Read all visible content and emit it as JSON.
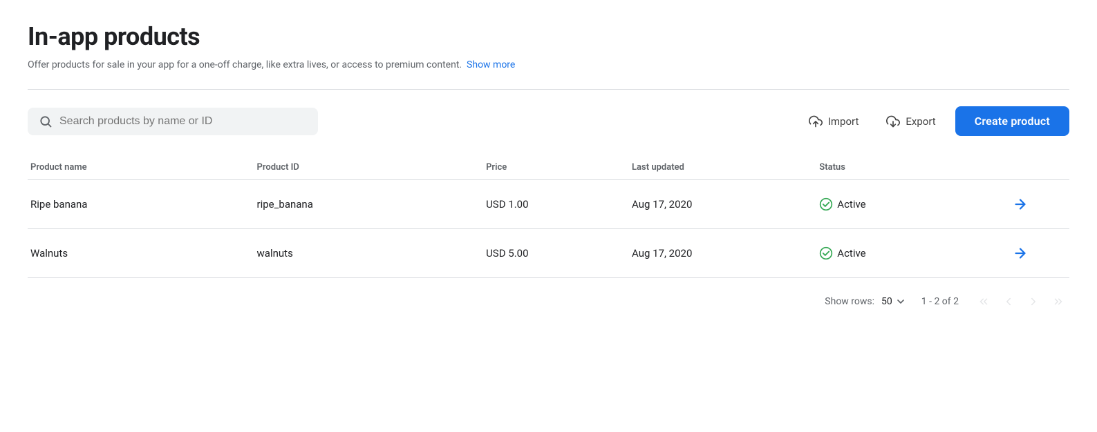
{
  "header": {
    "title": "In-app products",
    "subtitle": "Offer products for sale in your app for a one-off charge, like extra lives, or access to premium content.",
    "show_more_label": "Show more"
  },
  "toolbar": {
    "search_placeholder": "Search products by name or ID",
    "import_label": "Import",
    "export_label": "Export",
    "create_label": "Create product"
  },
  "table": {
    "columns": [
      {
        "key": "name",
        "label": "Product name"
      },
      {
        "key": "id",
        "label": "Product ID"
      },
      {
        "key": "price",
        "label": "Price"
      },
      {
        "key": "updated",
        "label": "Last updated"
      },
      {
        "key": "status",
        "label": "Status"
      }
    ],
    "rows": [
      {
        "name": "Ripe banana",
        "product_id": "ripe_banana",
        "price": "USD 1.00",
        "last_updated": "Aug 17, 2020",
        "status": "Active"
      },
      {
        "name": "Walnuts",
        "product_id": "walnuts",
        "price": "USD 5.00",
        "last_updated": "Aug 17, 2020",
        "status": "Active"
      }
    ]
  },
  "pagination": {
    "show_rows_label": "Show rows:",
    "rows_per_page": "50",
    "page_info": "1 - 2 of 2"
  },
  "colors": {
    "primary": "#1a73e8",
    "status_active": "#34a853"
  }
}
